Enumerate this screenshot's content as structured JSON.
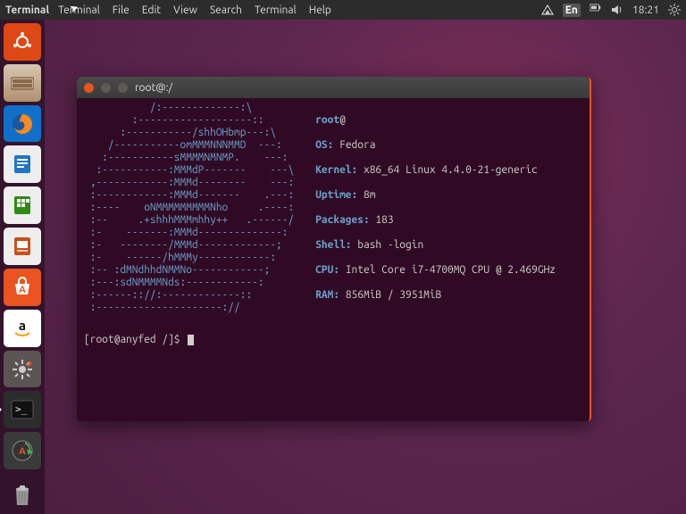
{
  "menubar": {
    "app_name": "Terminal",
    "items": [
      "Terminal",
      "File",
      "Edit",
      "View",
      "Search",
      "Terminal",
      "Help"
    ],
    "tray": {
      "lang": "En",
      "time": "18:21"
    }
  },
  "launcher": {
    "items": [
      {
        "name": "dash",
        "label": "Search",
        "bg": "#dd4814"
      },
      {
        "name": "files",
        "label": "Files",
        "bg": "#b48b6b"
      },
      {
        "name": "firefox",
        "label": "Firefox",
        "bg": "#1070c9"
      },
      {
        "name": "writer",
        "label": "LibreOffice Writer",
        "bg": "#2076c3"
      },
      {
        "name": "calc",
        "label": "LibreOffice Calc",
        "bg": "#2e8b13"
      },
      {
        "name": "impress",
        "label": "LibreOffice Impress",
        "bg": "#c94f19"
      },
      {
        "name": "software",
        "label": "Ubuntu Software",
        "bg": "#e95420"
      },
      {
        "name": "amazon",
        "label": "Amazon",
        "bg": "#ffffff"
      },
      {
        "name": "settings",
        "label": "System Settings",
        "bg": "#5a5552"
      },
      {
        "name": "terminal",
        "label": "Terminal",
        "bg": "#2c2c2c",
        "active": true
      },
      {
        "name": "updater",
        "label": "Software Updater",
        "bg": "#3a3a3a"
      }
    ],
    "trash": {
      "name": "trash",
      "label": "Trash"
    }
  },
  "window": {
    "title": "root@:/",
    "ascii": "           /:-------------:\\\n        :-------------------::\n      :-----------/shhOHbmp---:\\\n    /-----------omMMMNNNMMD  ---:\n   :-----------sMMMMNMNMP.    ---:\n  :-----------:MMMdP-------    ---\\\n ,------------:MMMd--------    ---:\n :------------:MMMd-------    .---:\n :----    oNMMMMMMMMMNho     .----:\n :--     .+shhhMMMmhhy++   .------/\n :-    -------:MMMd--------------:\n :-   --------/MMMd-------------;\n :-    ------/hMMMy------------:\n :-- :dMNdhhdNMMNo------------;\n :---:sdNMMMMNds:------------:\n :------:://:-------------::\n :---------------------://",
    "info": {
      "user": "root",
      "host": "@",
      "os_k": "OS:",
      "os_v": " Fedora ",
      "kernel_k": "Kernel:",
      "kernel_v": " x86_64 Linux 4.4.0-21-generic",
      "uptime_k": "Uptime:",
      "uptime_v": " 8m",
      "packages_k": "Packages:",
      "packages_v": " 183",
      "shell_k": "Shell:",
      "shell_v": " bash -login",
      "cpu_k": "CPU:",
      "cpu_v": " Intel Core i7-4700MQ CPU @ 2.469GHz",
      "ram_k": "RAM:",
      "ram_v": " 856MiB / 3951MiB"
    },
    "prompt": "[root@anyfed /]$ "
  }
}
